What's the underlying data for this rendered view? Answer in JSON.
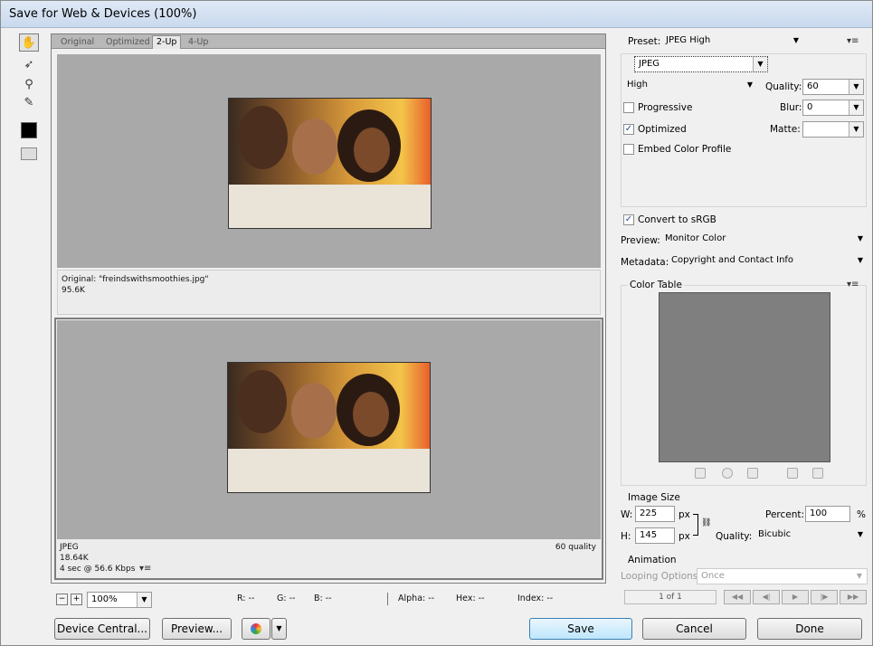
{
  "window": {
    "title": "Save for Web & Devices (100%)"
  },
  "tools": [
    "hand-tool-icon",
    "slice-select-tool-icon",
    "zoom-tool-icon",
    "eyedropper-tool-icon",
    "color-swatch",
    "toggle-slices-icon"
  ],
  "tabs": [
    "Original",
    "Optimized",
    "2-Up",
    "4-Up"
  ],
  "original_info": {
    "name": "Original: \"freindswithsmoothies.jpg\"",
    "size": "95.6K"
  },
  "optimized_info": {
    "format": "JPEG",
    "size": "18.64K",
    "speed": "4 sec @ 56.6 Kbps",
    "quality": "60 quality"
  },
  "zoom": {
    "minus": "−",
    "plus": "+",
    "value": "100%"
  },
  "readouts": {
    "r": "R: --",
    "g": "G: --",
    "b": "B: --",
    "alpha": "Alpha: --",
    "hex": "Hex: --",
    "index": "Index: --"
  },
  "bottom_buttons": {
    "device_central": "Device Central...",
    "preview": "Preview...",
    "save": "Save",
    "cancel": "Cancel",
    "done": "Done"
  },
  "settings": {
    "preset_label": "Preset:",
    "preset_value": "JPEG High",
    "format": "JPEG",
    "quality_level": "High",
    "quality_label": "Quality:",
    "quality_value": "60",
    "progressive": "Progressive",
    "progressive_checked": false,
    "blur_label": "Blur:",
    "blur_value": "0",
    "optimized": "Optimized",
    "optimized_checked": true,
    "matte_label": "Matte:",
    "matte_value": "",
    "embed_profile": "Embed Color Profile",
    "embed_checked": false,
    "convert_srgb": "Convert to sRGB",
    "convert_checked": true,
    "preview_label": "Preview:",
    "preview_value": "Monitor Color",
    "metadata_label": "Metadata:",
    "metadata_value": "Copyright and Contact Info"
  },
  "color_table": {
    "title": "Color Table"
  },
  "image_size": {
    "title": "Image Size",
    "w_label": "W:",
    "w_value": "225",
    "w_unit": "px",
    "h_label": "H:",
    "h_value": "145",
    "h_unit": "px",
    "percent_label": "Percent:",
    "percent_value": "100",
    "percent_unit": "%",
    "quality_label": "Quality:",
    "quality_value": "Bicubic"
  },
  "animation": {
    "title": "Animation",
    "looping_label": "Looping Options:",
    "looping_value": "Once",
    "frame": "1 of 1"
  }
}
